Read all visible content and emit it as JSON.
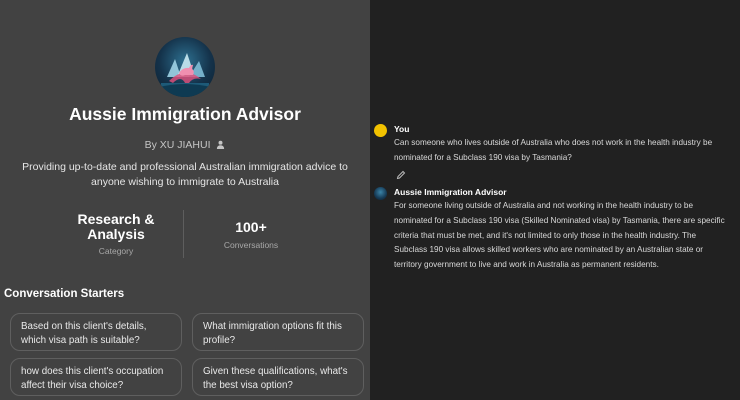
{
  "gpt": {
    "title": "Aussie Immigration Advisor",
    "author": "By XU JIAHUI",
    "description": "Providing up-to-date and professional Australian immigration advice to anyone wishing to immigrate to Australia",
    "avatar_icon": "kangaroo-opera-house-logo"
  },
  "stats": [
    {
      "value": "Research & Analysis",
      "label": "Category"
    },
    {
      "value": "100+",
      "label": "Conversations"
    }
  ],
  "starters": {
    "heading": "Conversation Starters",
    "items": [
      "Based on this client's details, which visa path is suitable?",
      "What immigration options fit this profile?",
      "how does this client's occupation affect their visa choice?",
      "Given these qualifications, what's the best visa option?"
    ]
  },
  "conversation": {
    "user": {
      "name": "You",
      "text": "Can someone who lives outside of Australia who does not work in the health industry be nominated for a Subclass 190 visa by Tasmania?",
      "avatar_color": "#f2c200"
    },
    "assistant": {
      "name": "Aussie Immigration Advisor",
      "text": "For someone living outside of Australia and not working in the health industry to be nominated for a Subclass 190 visa (Skilled Nominated visa) by Tasmania, there are specific criteria that must be met, and it's not limited to only those in the health industry. The Subclass 190 visa allows skilled workers who are nominated by an Australian state or territory government to live and work in Australia as permanent residents."
    }
  },
  "colors": {
    "left_panel_bg": "#424242",
    "right_panel_bg": "#212121"
  }
}
